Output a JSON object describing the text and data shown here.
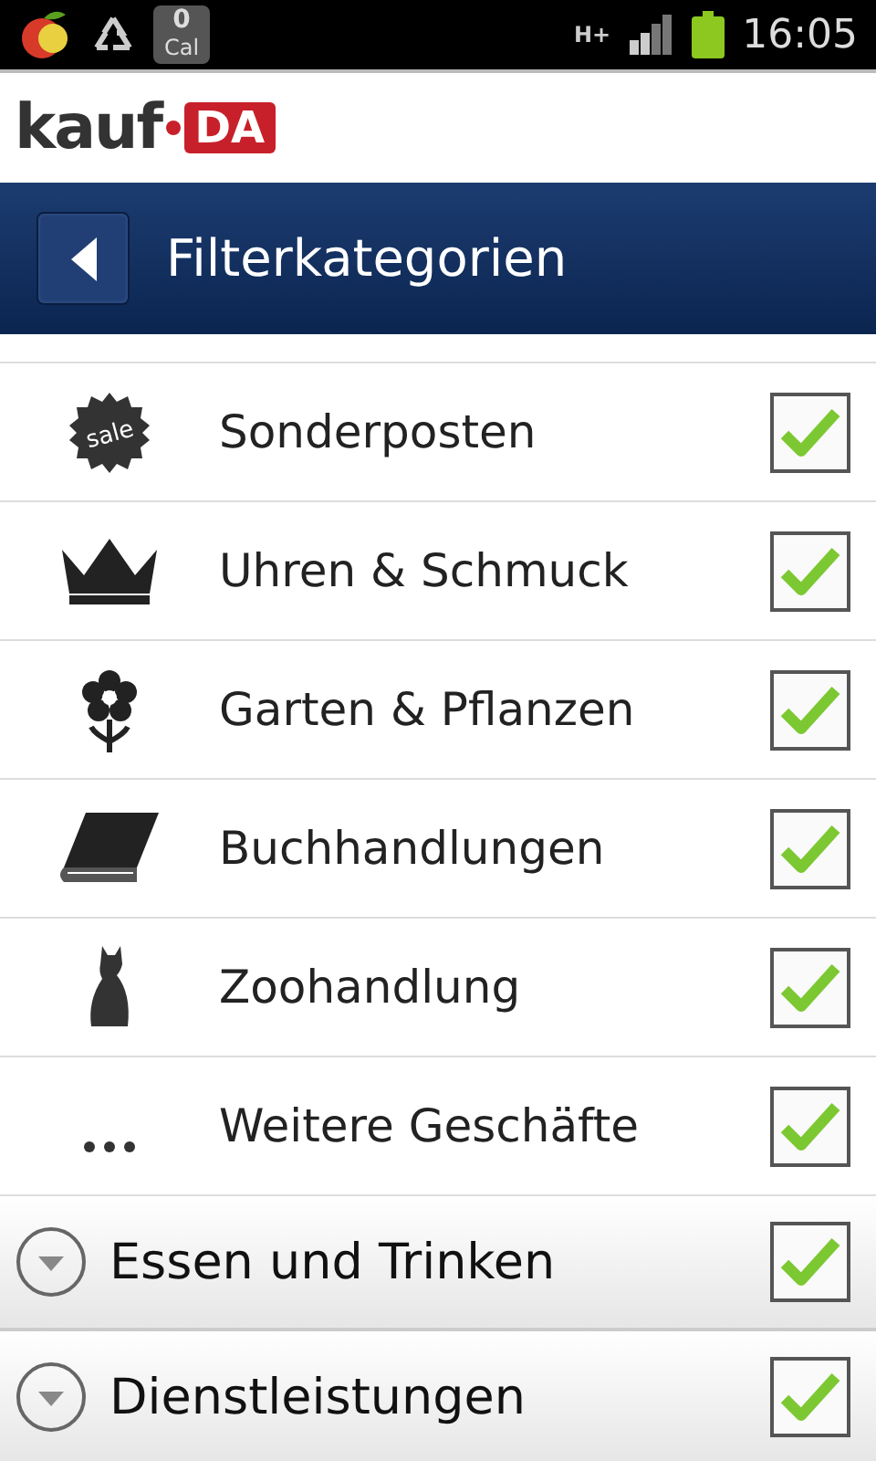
{
  "status_bar": {
    "cal_count": "0",
    "cal_label": "Cal",
    "network": "H+",
    "time": "16:05"
  },
  "logo": {
    "left": "kauf",
    "right": "DA"
  },
  "header": {
    "title": "Filterkategorien"
  },
  "categories": [
    {
      "kind": "sale",
      "icon_text": "sale",
      "label": "Sonderposten",
      "checked": true
    },
    {
      "kind": "crown",
      "label": "Uhren & Schmuck",
      "checked": true
    },
    {
      "kind": "flower",
      "label": "Garten & Pflanzen",
      "checked": true
    },
    {
      "kind": "book",
      "label": "Buchhandlungen",
      "checked": true
    },
    {
      "kind": "cat",
      "label": "Zoohandlung",
      "checked": true
    },
    {
      "kind": "more",
      "label": "Weitere Geschäfte",
      "checked": true
    }
  ],
  "groups": [
    {
      "label": "Essen und Trinken",
      "expanded": false,
      "checked": true
    },
    {
      "label": "Dienstleistungen",
      "expanded": false,
      "checked": true
    }
  ]
}
